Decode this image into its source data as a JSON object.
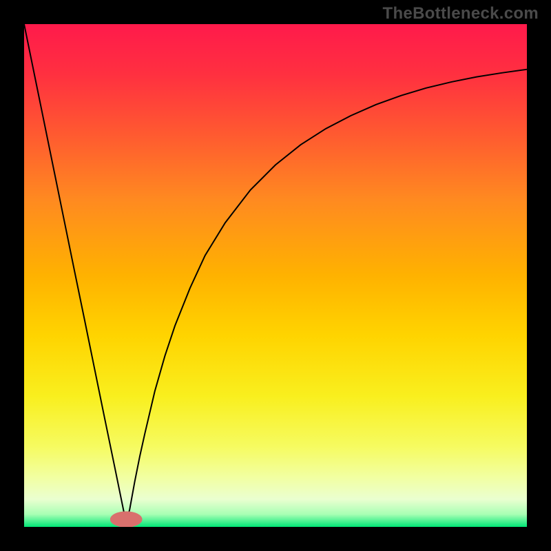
{
  "watermark": "TheBottleneck.com",
  "chart_data": {
    "type": "line",
    "title": "",
    "xlabel": "",
    "ylabel": "",
    "xlim": [
      0,
      100
    ],
    "ylim": [
      0,
      100
    ],
    "background_gradient": {
      "stops": [
        {
          "offset": 0.0,
          "color": "#ff1a4b"
        },
        {
          "offset": 0.1,
          "color": "#ff3040"
        },
        {
          "offset": 0.22,
          "color": "#ff5a30"
        },
        {
          "offset": 0.35,
          "color": "#ff8a20"
        },
        {
          "offset": 0.5,
          "color": "#ffb200"
        },
        {
          "offset": 0.62,
          "color": "#ffd400"
        },
        {
          "offset": 0.74,
          "color": "#f9ef1e"
        },
        {
          "offset": 0.84,
          "color": "#f6fb60"
        },
        {
          "offset": 0.9,
          "color": "#f2ffa0"
        },
        {
          "offset": 0.945,
          "color": "#eaffd0"
        },
        {
          "offset": 0.975,
          "color": "#a8ffb4"
        },
        {
          "offset": 1.0,
          "color": "#00e676"
        }
      ]
    },
    "marker": {
      "x": 20.3,
      "y": 1.5,
      "rx": 3.2,
      "ry": 1.6,
      "color": "#d9706d"
    },
    "series": [
      {
        "name": "curve",
        "color": "#000000",
        "stroke_width": 2,
        "x": [
          0,
          2,
          4,
          6,
          8,
          10,
          12,
          14,
          16,
          18,
          19,
          20,
          20.3,
          21,
          22,
          23,
          24,
          26,
          28,
          30,
          33,
          36,
          40,
          45,
          50,
          55,
          60,
          65,
          70,
          75,
          80,
          85,
          90,
          95,
          100
        ],
        "y": [
          100,
          90.2,
          80.4,
          70.6,
          60.8,
          51,
          41.3,
          31.5,
          21.7,
          12,
          7.1,
          2.2,
          0.7,
          3.5,
          9,
          14,
          18.5,
          27,
          34,
          40,
          47.5,
          54,
          60.5,
          67,
          72,
          76,
          79.2,
          81.8,
          84,
          85.8,
          87.3,
          88.5,
          89.5,
          90.3,
          91
        ]
      }
    ]
  }
}
